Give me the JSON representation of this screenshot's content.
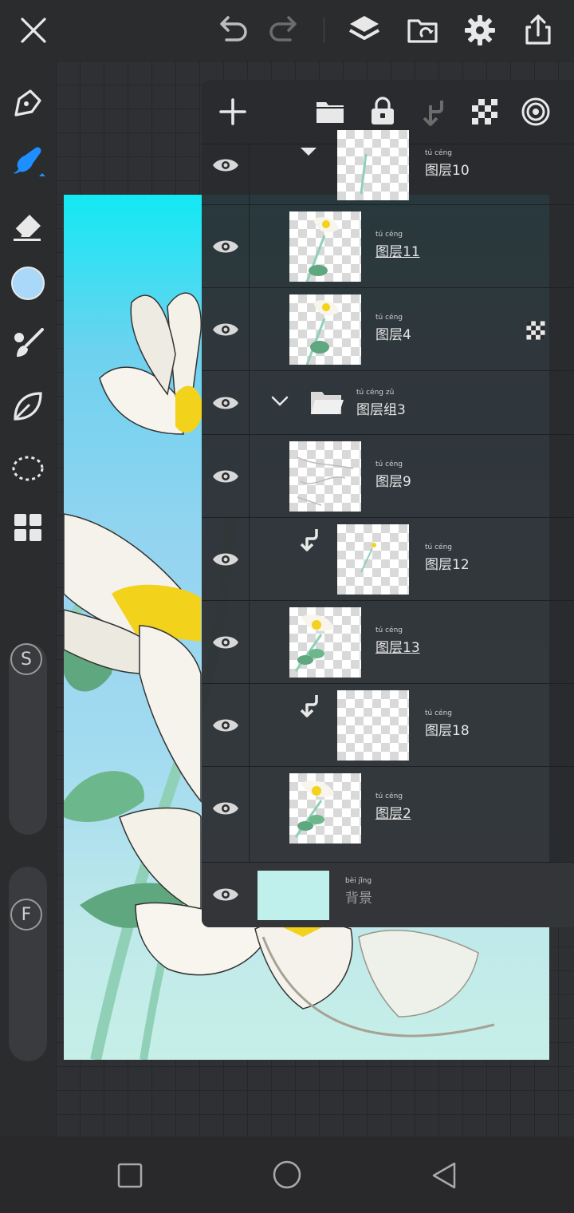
{
  "top_bar": {
    "icons": [
      "close-icon",
      "undo-icon",
      "redo-icon",
      "layers-icon",
      "gallery-icon",
      "settings-icon",
      "share-icon"
    ]
  },
  "left_toolbar": {
    "tools": [
      "pen-tool-icon",
      "brush-icon",
      "eraser-icon",
      "color-swatch",
      "smudge-icon",
      "leaf-shape-icon",
      "lasso-select-icon",
      "grid-icon"
    ],
    "brush_color": "#1e8fff",
    "swatch_color": "#a9d8f8",
    "size_slider_label": "S",
    "flow_slider_label": "F"
  },
  "layers_panel": {
    "toolbar_icons": [
      "add-layer-icon",
      "add-folder-icon",
      "lock-icon",
      "clip-icon",
      "alpha-lock-icon",
      "blend-icon"
    ],
    "layers": [
      {
        "name": "图层10",
        "ruby": "tú céng",
        "type": "layer",
        "clipped": false,
        "indent": true,
        "underline": false
      },
      {
        "name": "图层11",
        "ruby": "tú céng",
        "type": "layer",
        "clipped": false,
        "indent": false,
        "underline": true
      },
      {
        "name": "图层4",
        "ruby": "tú céng",
        "type": "layer",
        "clipped": false,
        "indent": false,
        "underline": false,
        "alpha_lock": true
      },
      {
        "name": "图层组3",
        "ruby": "tú céng zǔ",
        "type": "group"
      },
      {
        "name": "图层9",
        "ruby": "tú céng",
        "type": "layer",
        "clipped": false,
        "indent": false,
        "underline": false
      },
      {
        "name": "图层12",
        "ruby": "tú céng",
        "type": "layer",
        "clipped": true,
        "indent": true,
        "underline": false
      },
      {
        "name": "图层13",
        "ruby": "tú céng",
        "type": "layer",
        "clipped": false,
        "indent": false,
        "underline": true
      },
      {
        "name": "图层18",
        "ruby": "tú céng",
        "type": "layer",
        "clipped": true,
        "indent": true,
        "underline": false
      },
      {
        "name": "图层2",
        "ruby": "tú céng",
        "type": "layer",
        "clipped": false,
        "indent": false,
        "underline": true
      },
      {
        "name": "背景",
        "ruby": "bèi jǐng",
        "type": "background",
        "color": "#bff0ec"
      }
    ]
  },
  "bottom_nav": {
    "icons": [
      "recent-apps-icon",
      "home-icon",
      "back-icon"
    ]
  }
}
